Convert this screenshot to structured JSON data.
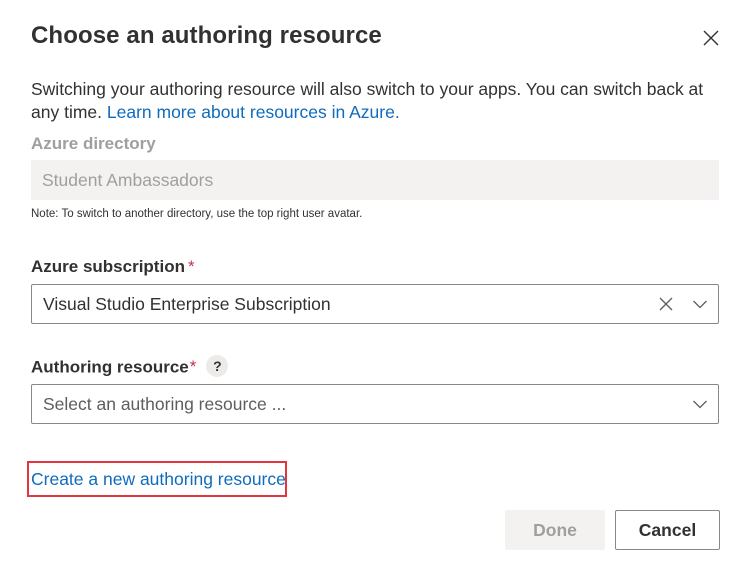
{
  "dialog": {
    "title": "Choose an authoring resource",
    "description_text": "Switching your authoring resource will also switch to your apps. You can switch back at any time.",
    "description_link": "Learn more about resources in Azure.",
    "directory": {
      "label": "Azure directory",
      "value": "Student Ambassadors",
      "note": "Note: To switch to another directory, use the top right user avatar."
    },
    "subscription": {
      "label": "Azure subscription",
      "required_mark": "*",
      "value": "Visual Studio Enterprise Subscription"
    },
    "authoring_resource": {
      "label": "Authoring resource",
      "required_mark": "*",
      "help_glyph": "?",
      "placeholder": "Select an authoring resource ..."
    },
    "create_link": "Create a new authoring resource",
    "buttons": {
      "done": "Done",
      "cancel": "Cancel"
    },
    "colors": {
      "link": "#0f6cbd",
      "required": "#c4314b",
      "highlight_border": "#e3353d",
      "disabled_bg": "#f3f2f1",
      "disabled_text": "#a19f9d"
    },
    "icons": {
      "close": "close-icon",
      "clear": "clear-icon",
      "chevron": "chevron-down-icon",
      "help": "help-icon"
    }
  }
}
